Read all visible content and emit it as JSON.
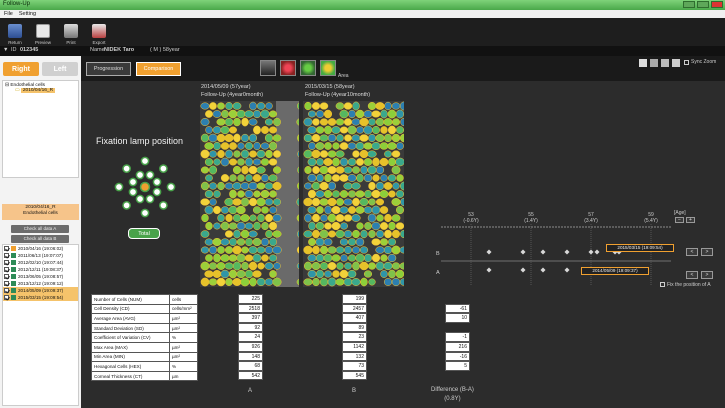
{
  "window": {
    "title": "Follow-Up"
  },
  "menu": {
    "items": [
      "File",
      "Setting"
    ]
  },
  "toolbar": {
    "buttons": [
      {
        "label": "Return",
        "icon": "return-icon"
      },
      {
        "label": "Preview",
        "icon": "preview-icon"
      },
      {
        "label": "Print",
        "icon": "printer-icon"
      },
      {
        "label": "Export",
        "icon": "export-icon"
      }
    ]
  },
  "patient": {
    "id_label": "ID",
    "id": "012345",
    "name_label": "Name",
    "name": "NIDEK Taro",
    "sex_age": "( M )  58year"
  },
  "topright": {
    "sync_zoom": "Sync Zoom"
  },
  "eye": {
    "right": "Right",
    "left": "Left",
    "right_color": "#f0a030"
  },
  "tree": {
    "root": "Endothelial cells",
    "child": "2010/04/16_R"
  },
  "info": {
    "line1": "2010/04/16_R",
    "line2": "Endothelial cells"
  },
  "check_all": {
    "a": "Check all data A",
    "b": "Check all data B"
  },
  "dates": [
    {
      "label": "2010/04/16 (19:06:02)",
      "checked": true,
      "color": "#f0a030",
      "hl": false
    },
    {
      "label": "2011/06/13 (19:07:07)",
      "checked": true,
      "color": "#2e8b57",
      "hl": false
    },
    {
      "label": "2012/02/10 (19:07:44)",
      "checked": true,
      "color": "#2e8b57",
      "hl": false
    },
    {
      "label": "2012/12/11 (19:08:37)",
      "checked": true,
      "color": "#2e8b57",
      "hl": false
    },
    {
      "label": "2013/06/05 (19:08:57)",
      "checked": true,
      "color": "#2e8b57",
      "hl": false
    },
    {
      "label": "2013/12/12 (19:09:12)",
      "checked": true,
      "color": "#2e8b57",
      "hl": false
    },
    {
      "label": "2014/05/09 (19:09:37)",
      "checked": true,
      "color": "#2e8b57",
      "hl": true
    },
    {
      "label": "2015/03/15 (19:09:54)",
      "checked": true,
      "color": "#2e8b57",
      "hl": true
    }
  ],
  "modes": {
    "progression": "Progression",
    "comparison": "Comparison",
    "area": "Area",
    "active_color": "#f0a030"
  },
  "fixation": {
    "title": "Fixation lamp position",
    "total": "Total"
  },
  "images": {
    "a": {
      "date": "2014/05/09 (57year)",
      "sub": "Follow-Up (4year0month)"
    },
    "b": {
      "date": "2015/03/15 (58year)",
      "sub": "Follow-Up (4year10month)"
    }
  },
  "metrics": {
    "rows": [
      {
        "name": "Number of Cells (NUM)",
        "unit": "cells",
        "a": "225",
        "b": "199",
        "diff": ""
      },
      {
        "name": "Cell Density (CD)",
        "unit": "cells/mm²",
        "a": "2518",
        "b": "2457",
        "diff": "-61"
      },
      {
        "name": "Average Area (AVG)",
        "unit": "µm²",
        "a": "397",
        "b": "407",
        "diff": "10"
      },
      {
        "name": "Standard Deviation (SD)",
        "unit": "µm²",
        "a": "92",
        "b": "89",
        "diff": ""
      },
      {
        "name": "Coefficient of Variation (CV)",
        "unit": "%",
        "a": "24",
        "b": "23",
        "diff": "-1"
      },
      {
        "name": "Max Area (MAX)",
        "unit": "µm²",
        "a": "926",
        "b": "1142",
        "diff": "216"
      },
      {
        "name": "Min Area (MIN)",
        "unit": "µm²",
        "a": "148",
        "b": "132",
        "diff": "-16"
      },
      {
        "name": "Hexagonal Cells (HEX)",
        "unit": "%",
        "a": "68",
        "b": "73",
        "diff": "5"
      },
      {
        "name": "Corneal Thickness (CT)",
        "unit": "µm",
        "a": "542",
        "b": "545",
        "diff": ""
      }
    ],
    "col_a": "A",
    "col_b": "B",
    "diff_label": "Difference (B-A)",
    "diff_years": "(0.8Y)"
  },
  "timeline": {
    "age_label": "[Age]",
    "ticks": [
      {
        "age": "53",
        "sub": "(-0.6Y)"
      },
      {
        "age": "55",
        "sub": "(1.4Y)"
      },
      {
        "age": "57",
        "sub": "(3.4Y)"
      },
      {
        "age": "59",
        "sub": "(5.4Y)"
      }
    ],
    "row_b": "B",
    "row_a": "A",
    "tag_b": "2015/03/15 (19:09:54)",
    "tag_a": "2014/05/09 (19:09:37)",
    "fix_label": "Fix the position of A",
    "prev": "<",
    "next": ">"
  }
}
